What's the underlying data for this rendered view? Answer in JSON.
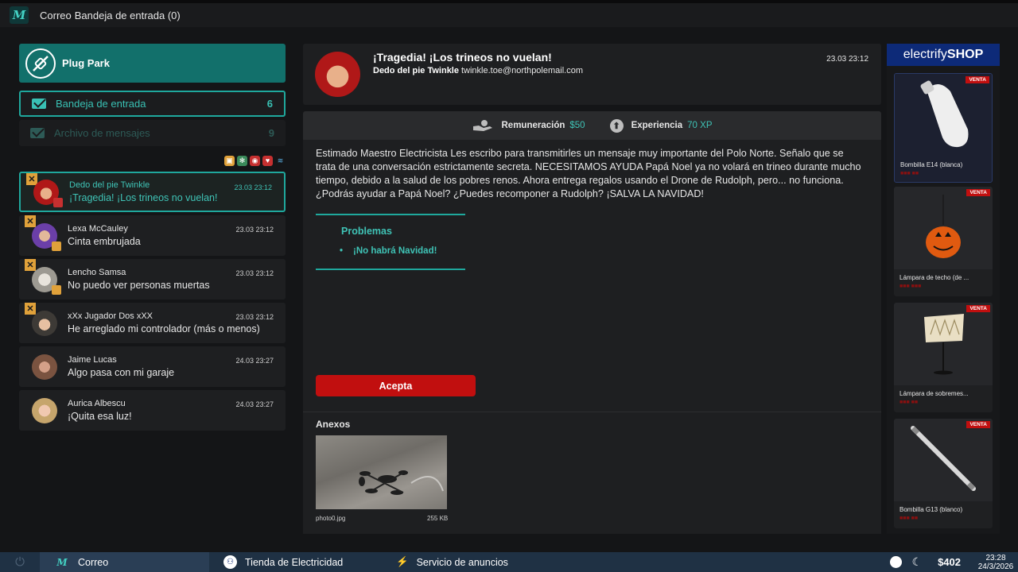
{
  "topbar": {
    "app": "Correo",
    "folder_title": "Bandeja de entrada (0)"
  },
  "sidebar": {
    "company": "Plug Park",
    "folders": [
      {
        "label": "Bandeja de entrada",
        "count": "6"
      },
      {
        "label": "Archivo de mensajes",
        "count": "9"
      }
    ],
    "messages": [
      {
        "sender": "Dedo del pie Twinkle",
        "subject": "¡Tragedia! ¡Los trineos no vuelan!",
        "time": "23.03 23:12"
      },
      {
        "sender": "Lexa McCauley",
        "subject": "Cinta embrujada",
        "time": "23.03 23:12"
      },
      {
        "sender": "Lencho Samsa",
        "subject": "No puedo ver personas muertas",
        "time": "23.03 23:12"
      },
      {
        "sender": "xXx Jugador Dos xXX",
        "subject": "He arreglado mi controlador (más o menos)",
        "time": "23.03 23:12"
      },
      {
        "sender": "Jaime Lucas",
        "subject": "Algo pasa con mi garaje",
        "time": "24.03 23:27"
      },
      {
        "sender": "Aurica Albescu",
        "subject": "¡Quita esa luz!",
        "time": "24.03 23:27"
      }
    ]
  },
  "email": {
    "subject": "¡Tragedia! ¡Los trineos no vuelan!",
    "sender_name": "Dedo del pie Twinkle",
    "sender_email": "twinkle.toe@northpolemail.com",
    "datetime": "23.03 23:12",
    "reward_label": "Remuneración",
    "reward_value": "$50",
    "xp_label": "Experiencia",
    "xp_value": "70 XP",
    "body": "Estimado Maestro Electricista Les escribo para transmitirles un mensaje muy importante del Polo Norte. Señalo que se trata de una conversación estrictamente secreta. NECESITAMOS AYUDA Papá Noel ya no volará en trineo durante mucho tiempo, debido a la salud de los pobres renos. Ahora entrega regalos usando el Drone de Rudolph, pero... no funciona. ¿Podrás ayudar a Papá Noel? ¿Puedes recomponer a Rudolph? ¡SALVA LA NAVIDAD!",
    "problems_title": "Problemas",
    "problems": [
      "¡No habrá Navidad!"
    ],
    "accept_label": "Acepta",
    "attachments_title": "Anexos",
    "attachment": {
      "name": "photo0.jpg",
      "size": "255 KB"
    }
  },
  "shop": {
    "brand_light": "electrify",
    "brand_bold": "SHOP",
    "sale_label": "VENTA",
    "products": [
      {
        "name": "Bombilla E14 (blanca)"
      },
      {
        "name": "Lámpara de techo (de ..."
      },
      {
        "name": "Lámpara de sobremes..."
      },
      {
        "name": "Bombilla G13 (blanco)"
      }
    ]
  },
  "taskbar": {
    "items": [
      "Correo",
      "Tienda de Electricidad",
      "Servicio de anuncios"
    ],
    "money": "$402",
    "time": "23:28",
    "date": "24/3/2026"
  },
  "colors": {
    "accent": "#1fa89d",
    "accent_text": "#3fc3b6",
    "danger": "#c10f0f",
    "brand_blue": "#0d2a78"
  }
}
